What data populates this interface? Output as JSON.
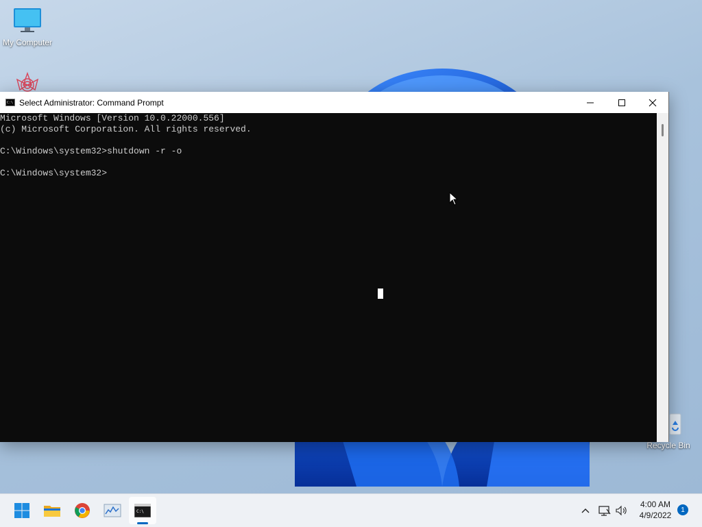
{
  "desktop": {
    "icons": [
      {
        "label": "My Computer",
        "icon": "monitor-icon"
      },
      {
        "label": "",
        "icon": "flower-logo-icon"
      },
      {
        "label": "Recycle Bin",
        "icon": "recycle-bin-icon"
      }
    ]
  },
  "window": {
    "title": "Select Administrator: Command Prompt",
    "icon": "cmd-icon",
    "controls": [
      "minimize-icon",
      "maximize-icon",
      "close-icon"
    ]
  },
  "console": {
    "lines": [
      "Microsoft Windows [Version 10.0.22000.556]",
      "(c) Microsoft Corporation. All rights reserved.",
      "",
      "C:\\Windows\\system32>shutdown -r -o",
      "",
      "C:\\Windows\\system32>"
    ]
  },
  "taskbar": {
    "apps": [
      {
        "name": "Start",
        "icon": "windows-start-icon"
      },
      {
        "name": "File Explorer",
        "icon": "folder-icon"
      },
      {
        "name": "Google Chrome",
        "icon": "chrome-icon"
      },
      {
        "name": "Resource Monitor",
        "icon": "monitor-graph-icon"
      },
      {
        "name": "Command Prompt",
        "icon": "cmd-icon",
        "active": true
      }
    ],
    "tray": [
      "chevron-up-icon",
      "network-icon",
      "volume-icon"
    ],
    "time": "4:00 AM",
    "date": "4/9/2022",
    "notification_count": "1"
  },
  "colors": {
    "console_bg": "#0c0c0c",
    "console_fg": "#cccccc",
    "accent": "#0067c0"
  }
}
